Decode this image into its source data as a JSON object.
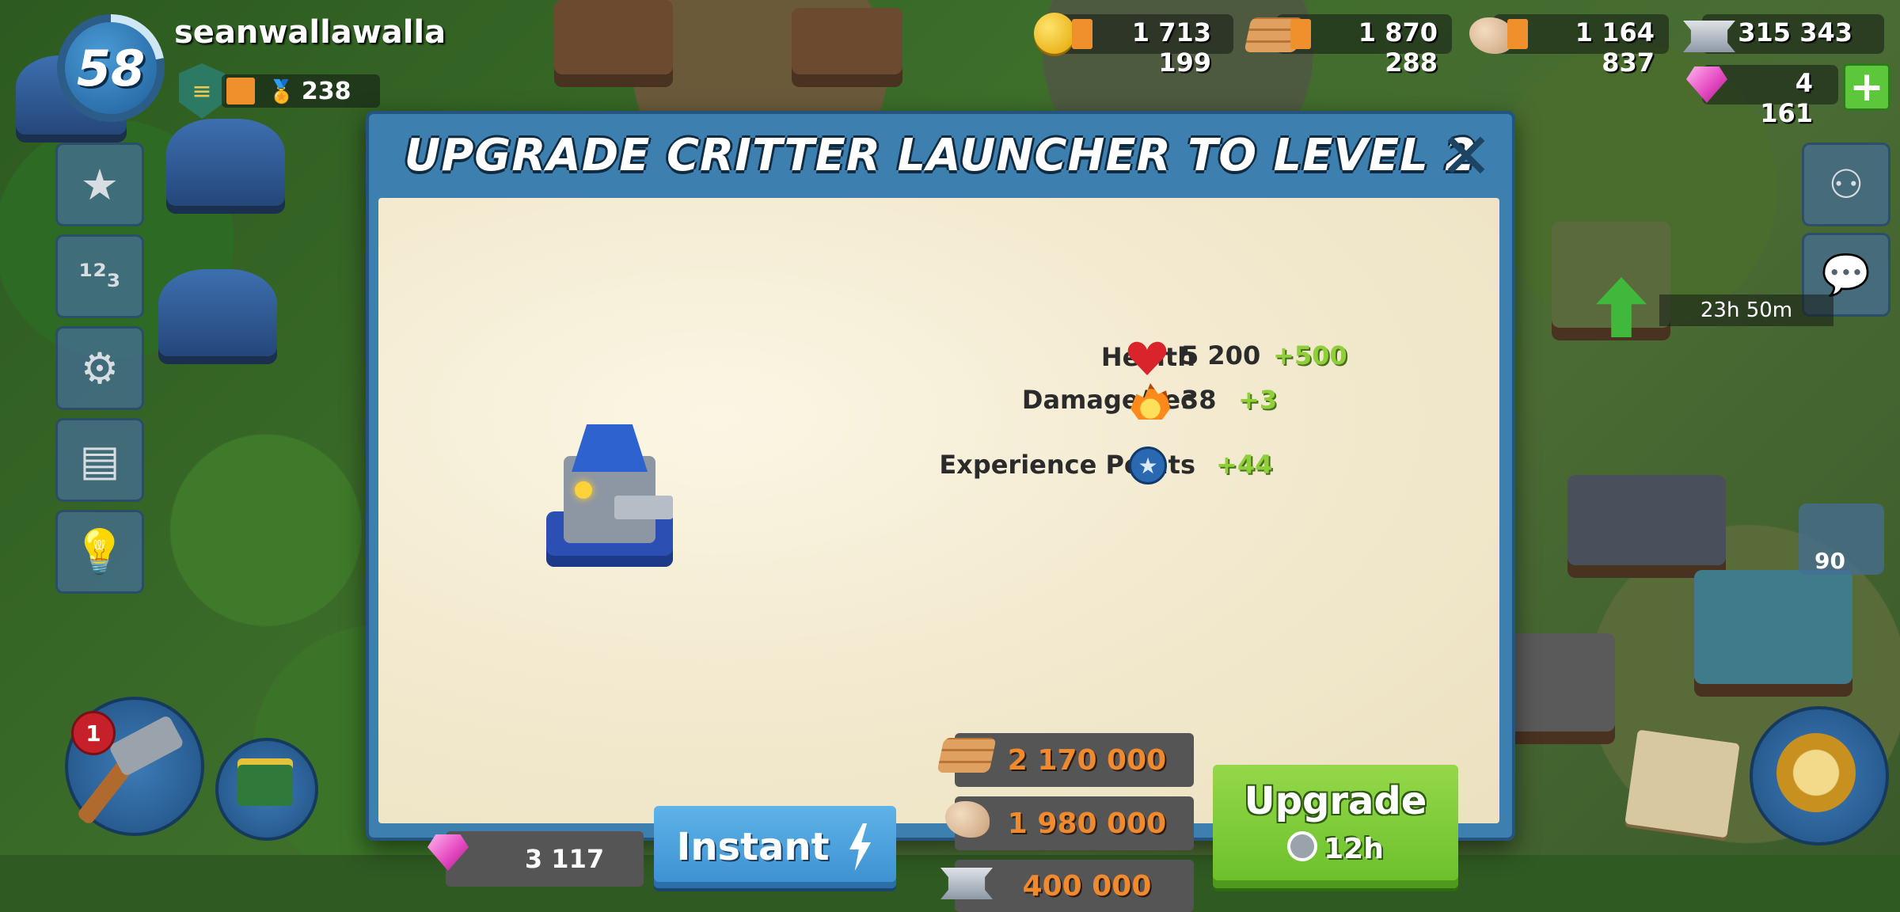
{
  "player": {
    "level": "58",
    "name": "seanwallawalla",
    "medals": "238"
  },
  "resources": {
    "gold": "1 713 199",
    "wood": "1 870 288",
    "stone": "1 164 837",
    "iron": "315 343",
    "gems": "4 161"
  },
  "side_menu": {
    "items": [
      "star",
      "leaderboard",
      "settings",
      "news",
      "hint"
    ]
  },
  "map": {
    "timer": "23h 50m",
    "gem_badge": "90",
    "builders_badge": "1"
  },
  "dialog": {
    "title": "UPGRADE CRITTER LAUNCHER TO LEVEL 2",
    "stats": [
      {
        "label": "Health",
        "value": "5 200",
        "increase": "+500"
      },
      {
        "label": "Damage/sec",
        "value": "38",
        "increase": "+3"
      },
      {
        "label": "Experience Points",
        "value": "",
        "increase": "+44"
      }
    ],
    "costs": {
      "wood": "2 170 000",
      "stone": "1 980 000",
      "iron": "400 000"
    },
    "gem_cost": "3 117",
    "instant_label": "Instant",
    "upgrade_label": "Upgrade",
    "upgrade_time": "12h"
  },
  "colors": {
    "dialog_frame": "#3d7fae",
    "upgrade_green": "#6abf2a",
    "instant_blue": "#3b8fd0",
    "cost_text": "#f08a2e",
    "plus_text": "#8fd03a"
  }
}
